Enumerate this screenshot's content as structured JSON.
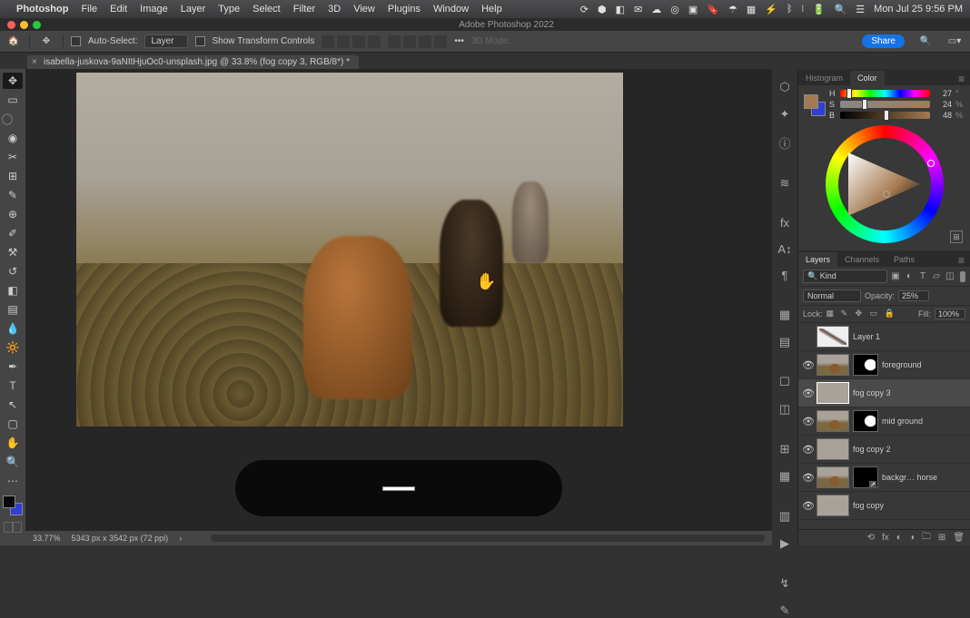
{
  "menubar": {
    "app": "Photoshop",
    "items": [
      "File",
      "Edit",
      "Image",
      "Layer",
      "Type",
      "Select",
      "Filter",
      "3D",
      "View",
      "Plugins",
      "Window",
      "Help"
    ],
    "datetime": "Mon Jul 25  9:56 PM"
  },
  "titlebar": {
    "title": "Adobe Photoshop 2022"
  },
  "options": {
    "auto_select_label": "Auto-Select:",
    "target": "Layer",
    "show_transform_label": "Show Transform Controls",
    "mode3d_label": "3D Mode:",
    "share_label": "Share"
  },
  "document": {
    "tab_label": "isabella-juskova-9aNItHjuOc0-unsplash.jpg @ 33.8% (fog copy 3, RGB/8*) *",
    "status_zoom": "33.77%",
    "status_dims": "5343 px x 3542 px (72 ppi)"
  },
  "color_panel": {
    "tabs": [
      "Histogram",
      "Color"
    ],
    "active_tab": "Color",
    "h_label": "H",
    "h_value": "27",
    "s_label": "S",
    "s_value": "24",
    "s_unit": "%",
    "b_label": "B",
    "b_value": "48",
    "b_unit": "%"
  },
  "layers_panel": {
    "tabs": [
      "Layers",
      "Channels",
      "Paths"
    ],
    "active_tab": "Layers",
    "kind_prefix": "🔍",
    "kind_label": "Kind",
    "blend_mode": "Normal",
    "opacity_label": "Opacity:",
    "opacity_value": "25%",
    "lock_label": "Lock:",
    "fill_label": "Fill:",
    "fill_value": "100%",
    "layers": [
      {
        "name": "Layer 1",
        "visible": false,
        "type": "curves",
        "mask": false,
        "active": false
      },
      {
        "name": "foreground",
        "visible": true,
        "type": "photo",
        "mask": "white-blob",
        "active": false
      },
      {
        "name": "fog copy 3",
        "visible": true,
        "type": "fog",
        "mask": false,
        "active": true
      },
      {
        "name": "mid ground",
        "visible": true,
        "type": "photo",
        "mask": "white-blob",
        "active": false
      },
      {
        "name": "fog copy 2",
        "visible": true,
        "type": "fog",
        "mask": false,
        "active": false
      },
      {
        "name": "backgr… horse",
        "visible": true,
        "type": "photo",
        "mask": "smart",
        "active": false
      },
      {
        "name": "fog copy",
        "visible": true,
        "type": "fog",
        "mask": false,
        "active": false
      }
    ]
  }
}
